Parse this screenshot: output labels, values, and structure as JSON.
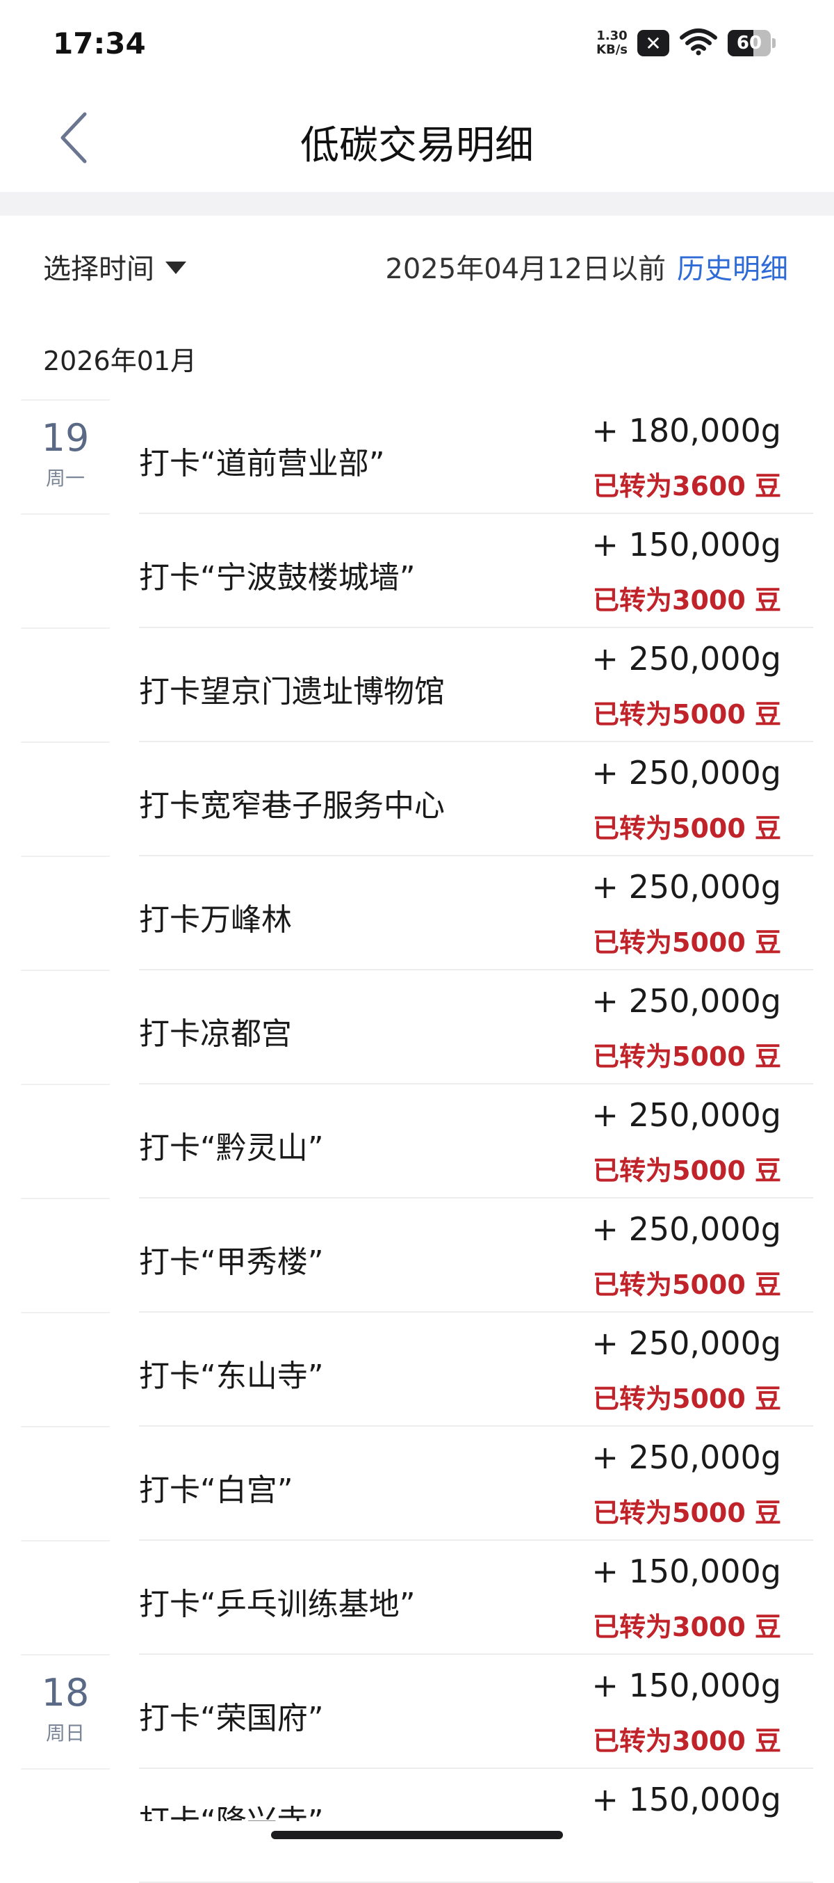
{
  "status_bar": {
    "time": "17:34",
    "net_speed_value": "1.30",
    "net_speed_unit": "KB/s",
    "x_badge": "✕",
    "battery_level": "60"
  },
  "header": {
    "title": "低碳交易明细",
    "back_icon": "chevron-left-icon"
  },
  "filter": {
    "select_time_label": "选择时间",
    "before_date_text": "2025年04月12日以前",
    "history_link_label": "历史明细"
  },
  "month_label": "2026年01月",
  "dates": {
    "d19": {
      "day": "19",
      "weekday": "周一"
    },
    "d18": {
      "day": "18",
      "weekday": "周日"
    }
  },
  "records": [
    {
      "title": "打卡“道前营业部”",
      "amount": "+ 180,000g",
      "note": "已转为3600 豆"
    },
    {
      "title": "打卡“宁波鼓楼城墙”",
      "amount": "+ 150,000g",
      "note": "已转为3000 豆"
    },
    {
      "title": "打卡望京门遗址博物馆",
      "amount": "+ 250,000g",
      "note": "已转为5000 豆"
    },
    {
      "title": "打卡宽窄巷子服务中心",
      "amount": "+ 250,000g",
      "note": "已转为5000 豆"
    },
    {
      "title": "打卡万峰林",
      "amount": "+ 250,000g",
      "note": "已转为5000 豆"
    },
    {
      "title": "打卡凉都宫",
      "amount": "+ 250,000g",
      "note": "已转为5000 豆"
    },
    {
      "title": "打卡“黔灵山”",
      "amount": "+ 250,000g",
      "note": "已转为5000 豆"
    },
    {
      "title": "打卡“甲秀楼”",
      "amount": "+ 250,000g",
      "note": "已转为5000 豆"
    },
    {
      "title": "打卡“东山寺”",
      "amount": "+ 250,000g",
      "note": "已转为5000 豆"
    },
    {
      "title": "打卡“白宫”",
      "amount": "+ 250,000g",
      "note": "已转为5000 豆"
    },
    {
      "title": "打卡“乒乓训练基地”",
      "amount": "+ 150,000g",
      "note": "已转为3000 豆"
    },
    {
      "title": "打卡“荣国府”",
      "amount": "+ 150,000g",
      "note": "已转为3000 豆"
    },
    {
      "title": "打卡“隆兴寺”",
      "amount": "+ 150,000g",
      "note": ""
    }
  ]
}
